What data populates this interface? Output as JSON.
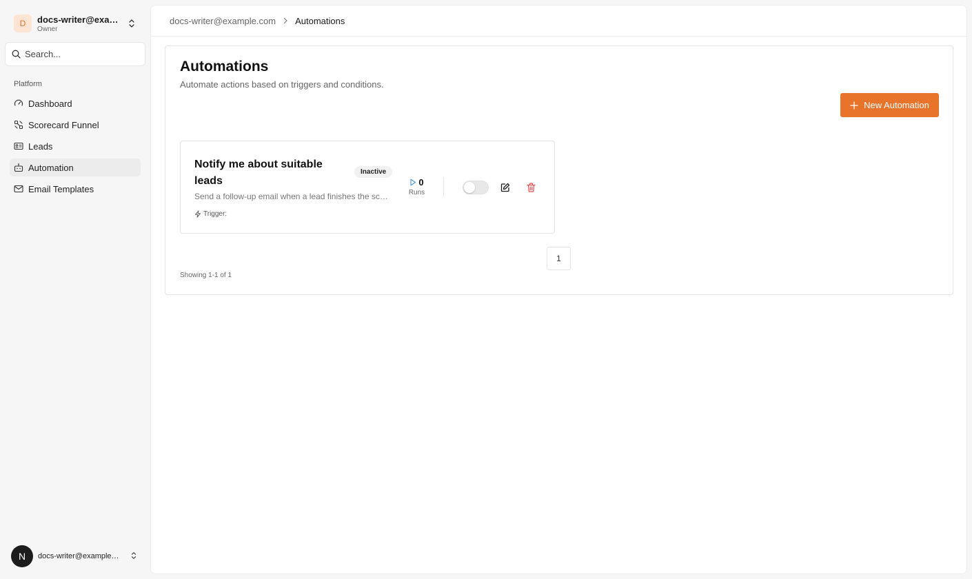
{
  "account": {
    "initial": "D",
    "email": "docs-writer@example.com",
    "role": "Owner"
  },
  "search": {
    "placeholder": "Search..."
  },
  "sidebar": {
    "group_label": "Platform",
    "items": [
      {
        "label": "Dashboard",
        "icon": "gauge-icon",
        "active": false
      },
      {
        "label": "Scorecard Funnel",
        "icon": "funnel-icon",
        "active": false
      },
      {
        "label": "Leads",
        "icon": "id-card-icon",
        "active": false
      },
      {
        "label": "Automation",
        "icon": "automation-icon",
        "active": true
      },
      {
        "label": "Email Templates",
        "icon": "mail-icon",
        "active": false
      }
    ]
  },
  "user": {
    "initial": "N",
    "email": "docs-writer@example.com"
  },
  "breadcrumb": {
    "root": "docs-writer@example.com",
    "current": "Automations"
  },
  "page": {
    "title": "Automations",
    "subtitle": "Automate actions based on triggers and conditions.",
    "new_button": "New Automation"
  },
  "automations": [
    {
      "title": "Notify me about suitable leads",
      "status": "Inactive",
      "description": "Send a follow-up email when a lead finishes the scorecard.",
      "trigger_label": "Trigger:",
      "runs": "0",
      "runs_label": "Runs",
      "enabled": false
    }
  ],
  "pagination": {
    "current_page": "1",
    "showing": "Showing 1-1 of 1"
  },
  "colors": {
    "accent": "#e8742c",
    "delete": "#e5484d"
  }
}
